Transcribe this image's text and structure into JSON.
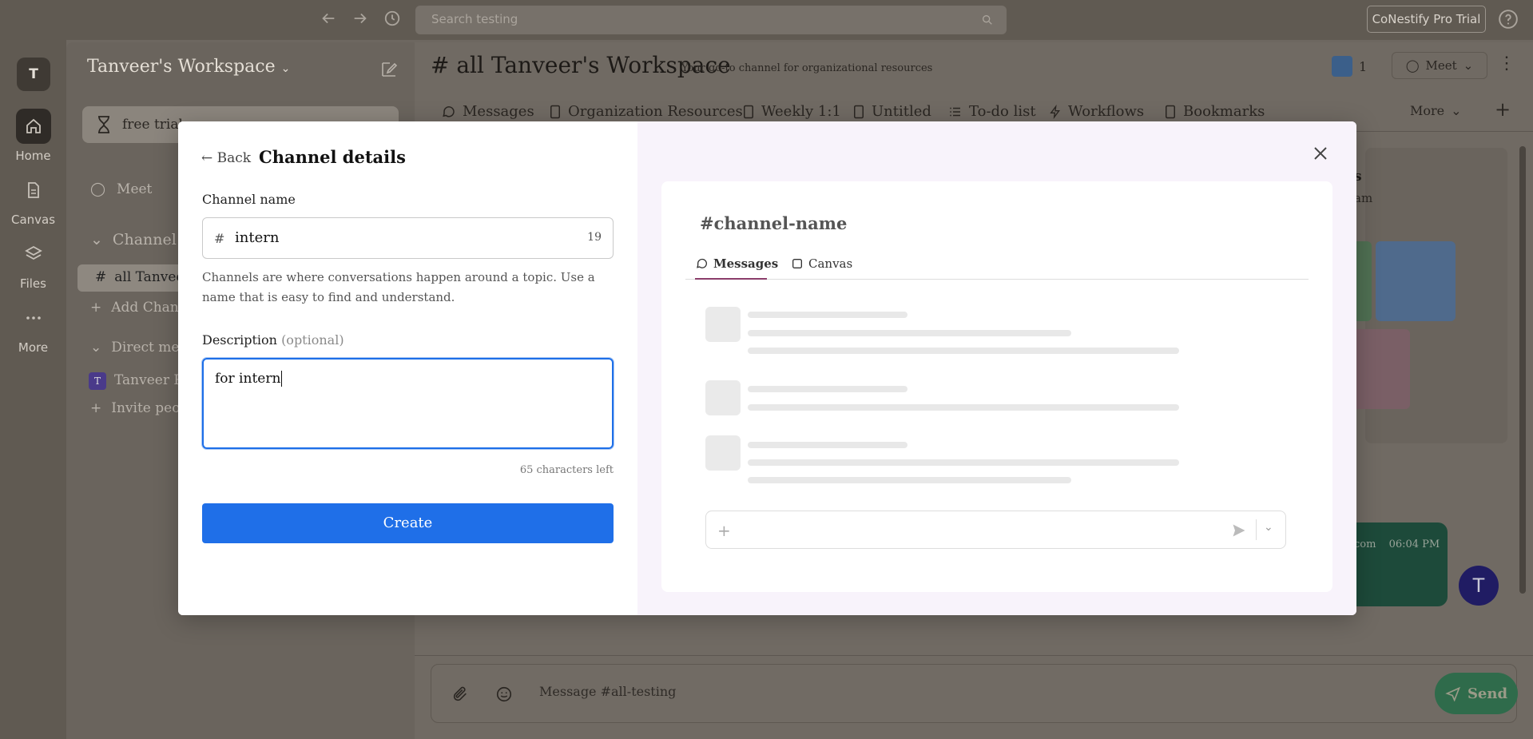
{
  "topbar": {
    "search_placeholder": "Search testing",
    "pro_button": "CoNestify Pro Trial"
  },
  "rail": {
    "avatar": "T",
    "items": [
      {
        "label": "Home",
        "icon": "home-icon"
      },
      {
        "label": "Canvas",
        "icon": "document-icon"
      },
      {
        "label": "Files",
        "icon": "layers-icon"
      },
      {
        "label": "More",
        "icon": "more-dots-icon"
      }
    ]
  },
  "sidebar": {
    "workspace_name": "Tanveer's Workspace",
    "trial_chip": "free trial",
    "meet": "Meet",
    "channels_header": "Channel",
    "active_channel": "all Tanveer",
    "add_channel": "Add Chan",
    "direct_header": "Direct me",
    "dm_user": "Tanveer R",
    "dm_avatar": "T",
    "invite": "Invite peo"
  },
  "main": {
    "channel_title": "# all Tanveer's Workspace",
    "channel_description": "Your go-to channel for organizational resources",
    "member_count": "1",
    "meet_label": "Meet",
    "tabs": [
      {
        "label": "Messages",
        "icon": "message-icon"
      },
      {
        "label": "Organization Resources",
        "icon": "doc-icon"
      },
      {
        "label": "Weekly 1:1",
        "icon": "doc-icon"
      },
      {
        "label": "Untitled",
        "icon": "doc-icon"
      },
      {
        "label": "To-do list",
        "icon": "list-icon"
      },
      {
        "label": "Workflows",
        "icon": "bolt-icon"
      },
      {
        "label": "Bookmarks",
        "icon": "bookmark-icon"
      }
    ],
    "more_label": "More",
    "composer_placeholder": "Message #all-testing",
    "send_label": "Send",
    "partial_heading": "s",
    "partial_sub": "am",
    "partial_msg_tail": "com",
    "partial_msg_time": "06:04 PM",
    "float_avatar": "T"
  },
  "modal": {
    "back_label": "Back",
    "title": "Channel details",
    "name_label": "Channel name",
    "name_prefix": "#",
    "name_value": "intern",
    "name_counter": "19",
    "name_help": "Channels are where conversations happen around a topic. Use a name that is easy to find and understand.",
    "desc_label": "Description",
    "desc_optional": "(optional)",
    "desc_value": "for intern",
    "chars_left": "65 characters left",
    "create_label": "Create",
    "preview": {
      "title": "channel-name",
      "hash": "#",
      "tab_messages": "Messages",
      "tab_canvas": "Canvas"
    }
  },
  "colors": {
    "primary_blue": "#1f6fe8",
    "overlay_dim": "#6d6760",
    "preview_bg": "#f8f3fb",
    "tab_underline": "#8a3d6b"
  }
}
